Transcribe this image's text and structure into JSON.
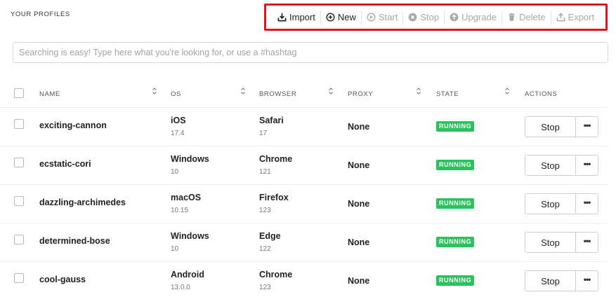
{
  "section_title": "YOUR PROFILES",
  "toolbar": {
    "import_label": "Import",
    "new_label": "New",
    "start_label": "Start",
    "stop_label": "Stop",
    "upgrade_label": "Upgrade",
    "delete_label": "Delete",
    "export_label": "Export",
    "highlight_color": "#e0161b"
  },
  "search": {
    "placeholder": "Searching is easy! Type here what you're looking for, or use a #hashtag",
    "value": ""
  },
  "table": {
    "headers": {
      "name": "NAME",
      "os": "OS",
      "browser": "BROWSER",
      "proxy": "PROXY",
      "state": "STATE",
      "actions": "ACTIONS"
    },
    "rows": [
      {
        "name": "exciting-cannon",
        "os": "iOS",
        "os_version": "17.4",
        "browser": "Safari",
        "browser_version": "17",
        "proxy": "None",
        "state": "RUNNING",
        "action": "Stop",
        "more": "•••"
      },
      {
        "name": "ecstatic-cori",
        "os": "Windows",
        "os_version": "10",
        "browser": "Chrome",
        "browser_version": "121",
        "proxy": "None",
        "state": "RUNNING",
        "action": "Stop",
        "more": "•••"
      },
      {
        "name": "dazzling-archimedes",
        "os": "macOS",
        "os_version": "10.15",
        "browser": "Firefox",
        "browser_version": "123",
        "proxy": "None",
        "state": "RUNNING",
        "action": "Stop",
        "more": "•••"
      },
      {
        "name": "determined-bose",
        "os": "Windows",
        "os_version": "10",
        "browser": "Edge",
        "browser_version": "122",
        "proxy": "None",
        "state": "RUNNING",
        "action": "Stop",
        "more": "•••"
      },
      {
        "name": "cool-gauss",
        "os": "Android",
        "os_version": "13.0.0",
        "browser": "Chrome",
        "browser_version": "123",
        "proxy": "None",
        "state": "RUNNING",
        "action": "Stop",
        "more": "•••"
      }
    ]
  },
  "colors": {
    "running_badge": "#28c35d"
  }
}
